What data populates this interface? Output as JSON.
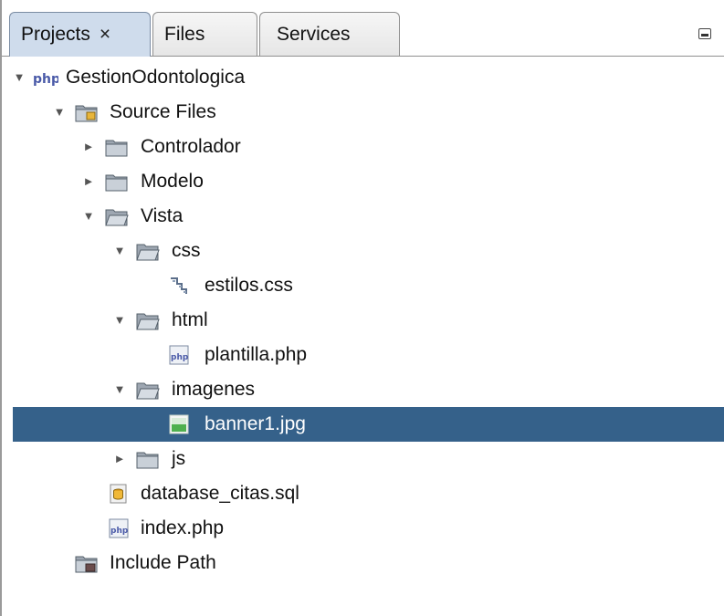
{
  "tabs": [
    {
      "label": "Projects",
      "close": "×",
      "active": true
    },
    {
      "label": "Files",
      "active": false
    },
    {
      "label": "Services",
      "active": false
    }
  ],
  "tree": {
    "root": "GestionOdontologica",
    "source_files": "Source Files",
    "controlador": "Controlador",
    "modelo": "Modelo",
    "vista": "Vista",
    "css": "css",
    "estilos": "estilos.css",
    "html": "html",
    "plantilla": "plantilla.php",
    "imagenes": "imagenes",
    "banner": "banner1.jpg",
    "js": "js",
    "database": "database_citas.sql",
    "index": "index.php",
    "include_path": "Include Path"
  },
  "icons": {
    "expanded": "triangle-down",
    "collapsed": "triangle-right",
    "project": "php-project-icon",
    "folder": "folder-icon",
    "css_file": "css-file-icon",
    "php_file": "php-file-icon",
    "image_file": "image-file-icon",
    "sql_file": "sql-file-icon",
    "library": "library-icon"
  },
  "colors": {
    "selection": "#35618a",
    "active_tab": "#cfdcec"
  }
}
